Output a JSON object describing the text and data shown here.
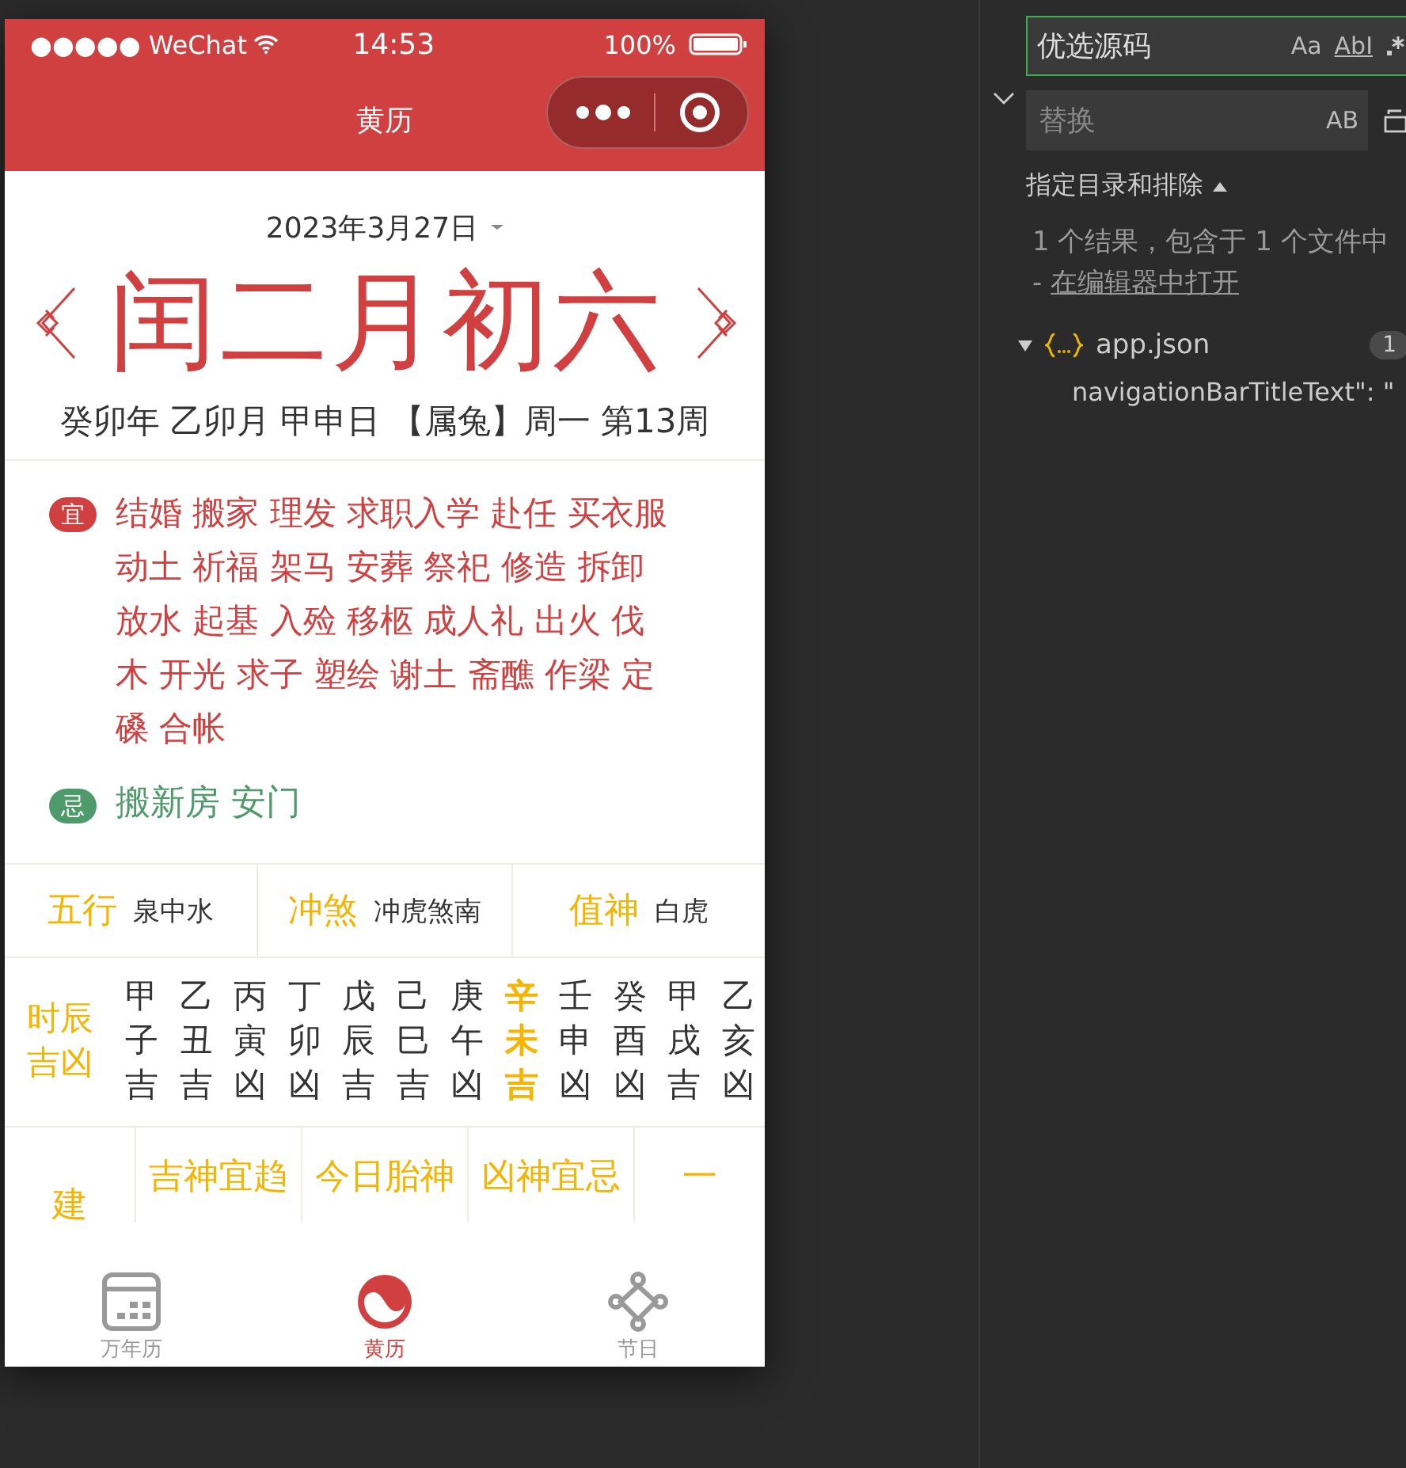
{
  "status_bar": {
    "carrier": "●●●●● WeChat",
    "time": "14:53",
    "battery": "100%"
  },
  "nav": {
    "title": "黄历"
  },
  "date": {
    "solar": "2023年3月27日",
    "lunar": "闰二月初六",
    "ganzhi": "癸卯年 乙卯月 甲申日 【属兔】周一 第13周"
  },
  "yi": {
    "tag": "宜",
    "lines": [
      "结婚 搬家 理发 求职入学 赴任 买衣服",
      "动土 祈福 架马 安葬 祭祀 修造 拆卸",
      "放水 起基 入殓 移柩 成人礼 出火 伐",
      "木 开光 求子 塑绘 谢土 斋醮 作梁 定",
      "磉 合帐"
    ]
  },
  "ji": {
    "tag": "忌",
    "text": "搬新房 安门"
  },
  "info": [
    {
      "label": "五行",
      "value": "泉中水"
    },
    {
      "label": "冲煞",
      "value": "冲虎煞南"
    },
    {
      "label": "值神",
      "value": "白虎"
    }
  ],
  "hours": {
    "label": "时辰吉凶",
    "items": [
      {
        "stem": "甲",
        "branch": "子",
        "luck": "吉",
        "selected": false
      },
      {
        "stem": "乙",
        "branch": "丑",
        "luck": "吉",
        "selected": false
      },
      {
        "stem": "丙",
        "branch": "寅",
        "luck": "凶",
        "selected": false
      },
      {
        "stem": "丁",
        "branch": "卯",
        "luck": "凶",
        "selected": false
      },
      {
        "stem": "戊",
        "branch": "辰",
        "luck": "吉",
        "selected": false
      },
      {
        "stem": "己",
        "branch": "巳",
        "luck": "吉",
        "selected": false
      },
      {
        "stem": "庚",
        "branch": "午",
        "luck": "凶",
        "selected": false
      },
      {
        "stem": "辛",
        "branch": "未",
        "luck": "吉",
        "selected": true
      },
      {
        "stem": "壬",
        "branch": "申",
        "luck": "凶",
        "selected": false
      },
      {
        "stem": "癸",
        "branch": "酉",
        "luck": "凶",
        "selected": false
      },
      {
        "stem": "甲",
        "branch": "戌",
        "luck": "吉",
        "selected": false
      },
      {
        "stem": "乙",
        "branch": "亥",
        "luck": "凶",
        "selected": false
      }
    ]
  },
  "bottom_row": [
    "建",
    "吉神宜趋",
    "今日胎神",
    "凶神宜忌",
    "一"
  ],
  "tabbar": [
    {
      "label": "万年历",
      "kind": "calendar",
      "selected": false
    },
    {
      "label": "黄历",
      "kind": "yinyang",
      "selected": true
    },
    {
      "label": "节日",
      "kind": "nodes",
      "selected": false
    }
  ],
  "search_panel": {
    "search_value": "优选源码",
    "search_options": [
      "Aa",
      "AbI"
    ],
    "replace_placeholder": "替换",
    "replace_option": "AB",
    "scope": "指定目录和排除",
    "result_text": "1 个结果，包含于 1 个文件中 - ",
    "result_link": "在编辑器中打开",
    "file": {
      "name": "app.json",
      "count": "1",
      "expanded": true,
      "match": "navigationBarTitleText\": \""
    }
  }
}
